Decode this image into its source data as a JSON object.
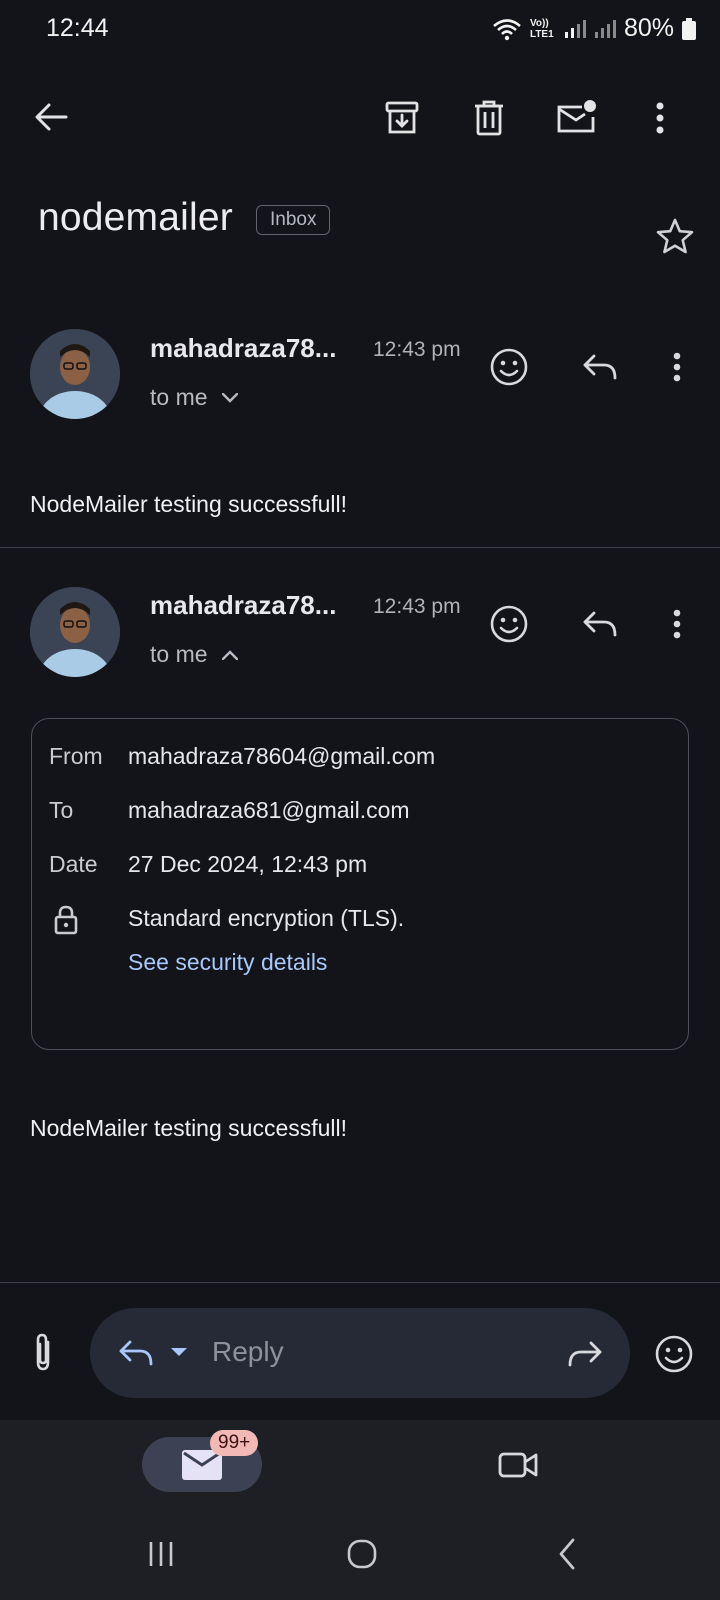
{
  "status_bar": {
    "time": "12:44",
    "network_label": "Vo)) LTE1",
    "battery": "80%"
  },
  "toolbar": {
    "back_icon": "arrow-left-icon",
    "archive_icon": "archive-icon",
    "delete_icon": "trash-icon",
    "mark_unread_icon": "mail-unread-icon",
    "more_icon": "more-vert-icon"
  },
  "email": {
    "subject": "nodemailer",
    "label": "Inbox"
  },
  "messages": [
    {
      "sender": "mahadraza78...",
      "time": "12:43 pm",
      "recipient": "to me",
      "body": "NodeMailer testing successfull!"
    },
    {
      "sender": "mahadraza78...",
      "time": "12:43 pm",
      "recipient": "to me",
      "details": {
        "from_label": "From",
        "from_value": "mahadraza78604@gmail.com",
        "to_label": "To",
        "to_value": "mahadraza681@gmail.com",
        "date_label": "Date",
        "date_value": "27 Dec 2024, 12:43 pm",
        "encryption": "Standard encryption (TLS).",
        "security_link": "See security details"
      },
      "body": "NodeMailer testing successfull!"
    }
  ],
  "reply_bar": {
    "placeholder": "Reply"
  },
  "bottom_nav": {
    "mail_badge": "99+"
  },
  "colors": {
    "background": "#131419",
    "link": "#a8c7fa",
    "badge": "#f2b8b5",
    "nav_pill": "#3c4154"
  }
}
